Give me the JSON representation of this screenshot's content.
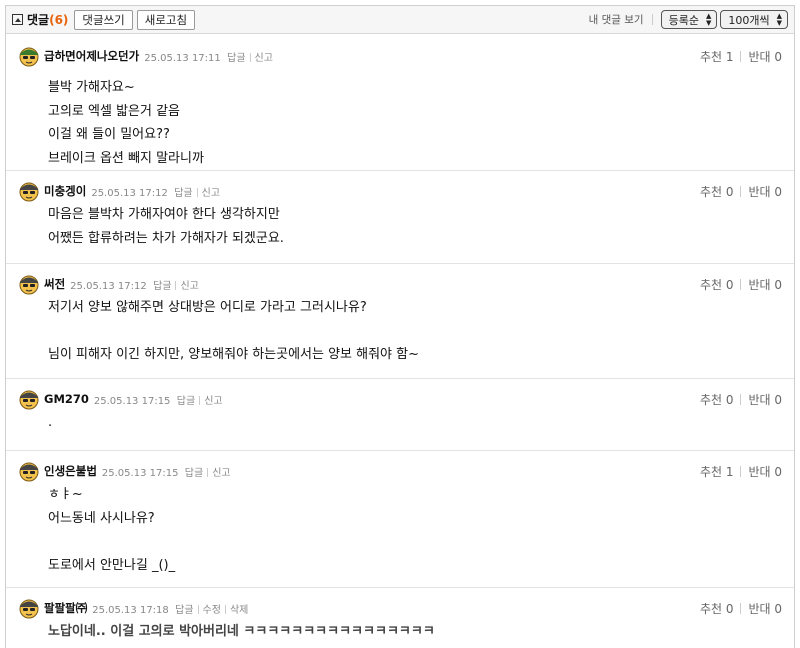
{
  "toolbar": {
    "title": "댓글",
    "count": "(6)",
    "write_label": "댓글쓰기",
    "refresh_label": "새로고침",
    "my_comments_label": "내 댓글 보기",
    "sort_value": "등록순",
    "page_size_value": "100개씩"
  },
  "comments": [
    {
      "nick": "급하면어제나오던가",
      "date": "25.05.13 17:11",
      "actions": [
        "답글",
        "신고"
      ],
      "up": "추천 1",
      "down": "반대 0",
      "text": "블박 가해자요~\n고의로 엑셀 밟은거 같음\n이걸 왜 들이 밀어요??\n브레이크 옵션 빼지 말라니까"
    },
    {
      "nick": "미충겡이",
      "date": "25.05.13 17:12",
      "actions": [
        "답글",
        "신고"
      ],
      "up": "추천 0",
      "down": "반대 0",
      "text": "마음은 블박차 가해자여야 한다 생각하지만\n어쨌든 합류하려는 차가 가해자가 되겠군요."
    },
    {
      "nick": "써전",
      "date": "25.05.13 17:12",
      "actions": [
        "답글",
        "신고"
      ],
      "up": "추천 0",
      "down": "반대 0",
      "text": "저기서 양보 않해주면 상대방은 어디로 가라고 그러시나유?\n\n님이 피해자 이긴 하지만, 양보해줘야 하는곳에서는 양보 해줘야 함~"
    },
    {
      "nick": "GM270",
      "date": "25.05.13 17:15",
      "actions": [
        "답글",
        "신고"
      ],
      "up": "추천 0",
      "down": "반대 0",
      "text": "."
    },
    {
      "nick": "인생은불법",
      "date": "25.05.13 17:15",
      "actions": [
        "답글",
        "신고"
      ],
      "up": "추천 1",
      "down": "반대 0",
      "text": "ㅎㅑ~\n어느동네 사시나유?\n\n도로에서 안만나길 _()_"
    },
    {
      "nick": "팔팔팔㈜",
      "date": "25.05.13 17:18",
      "actions": [
        "답글",
        "수정",
        "삭제"
      ],
      "up": "추천 0",
      "down": "반대 0",
      "text": "노답이네.. 이걸 고의로 박아버리네 ㅋㅋㅋㅋㅋㅋㅋㅋㅋㅋㅋㅋㅋㅋㅋㅋ"
    }
  ]
}
